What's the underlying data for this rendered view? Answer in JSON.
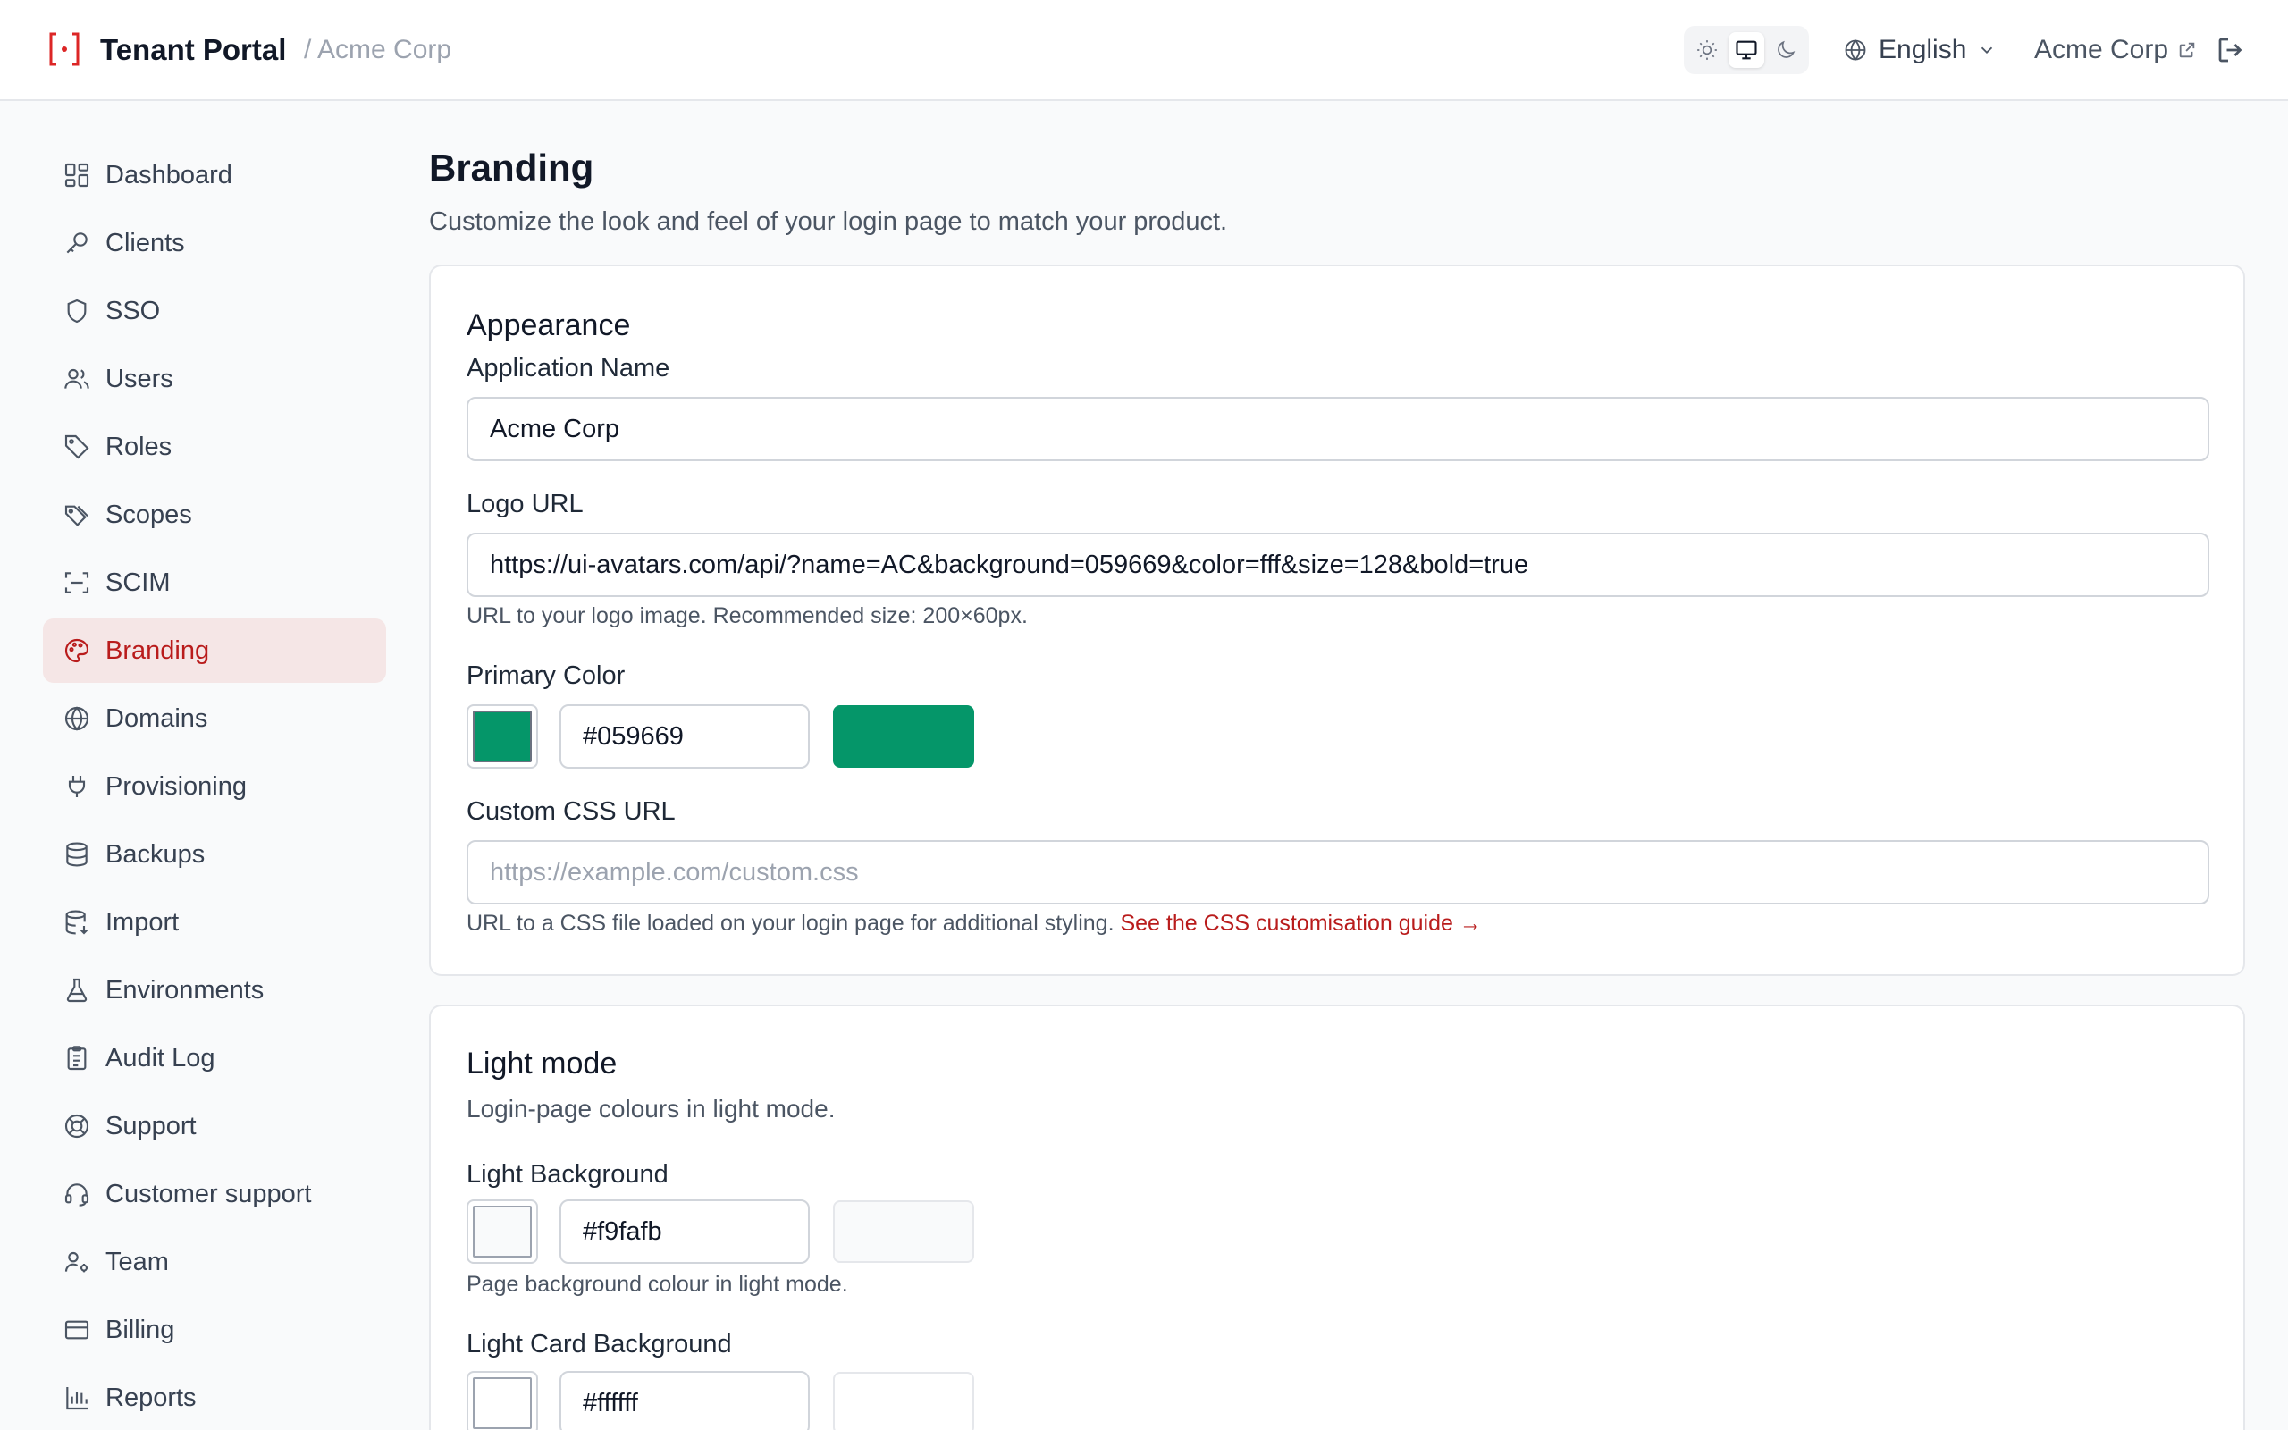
{
  "header": {
    "app_title": "Tenant Portal",
    "breadcrumb": "/ Acme Corp",
    "theme_options": [
      "light-icon",
      "system-icon",
      "dark-icon"
    ],
    "theme_active": "system",
    "language": "English",
    "tenant_link": "Acme Corp"
  },
  "sidebar": {
    "items": [
      {
        "label": "Dashboard",
        "icon": "dashboard-icon"
      },
      {
        "label": "Clients",
        "icon": "key-icon"
      },
      {
        "label": "SSO",
        "icon": "shield-icon"
      },
      {
        "label": "Users",
        "icon": "users-icon"
      },
      {
        "label": "Roles",
        "icon": "tag-icon"
      },
      {
        "label": "Scopes",
        "icon": "tags-icon"
      },
      {
        "label": "SCIM",
        "icon": "scan-icon"
      },
      {
        "label": "Branding",
        "icon": "palette-icon",
        "active": true
      },
      {
        "label": "Domains",
        "icon": "globe-icon"
      },
      {
        "label": "Provisioning",
        "icon": "plug-icon"
      },
      {
        "label": "Backups",
        "icon": "database-icon"
      },
      {
        "label": "Import",
        "icon": "database-import-icon"
      },
      {
        "label": "Environments",
        "icon": "flask-icon"
      },
      {
        "label": "Audit Log",
        "icon": "clipboard-icon"
      },
      {
        "label": "Support",
        "icon": "lifebuoy-icon"
      },
      {
        "label": "Customer support",
        "icon": "headset-icon"
      },
      {
        "label": "Team",
        "icon": "user-cog-icon"
      },
      {
        "label": "Billing",
        "icon": "credit-card-icon"
      },
      {
        "label": "Reports",
        "icon": "bar-chart-icon"
      }
    ]
  },
  "page": {
    "title": "Branding",
    "subtitle": "Customize the look and feel of your login page to match your product."
  },
  "appearance": {
    "title": "Appearance",
    "app_name_label": "Application Name",
    "app_name_value": "Acme Corp",
    "logo_url_label": "Logo URL",
    "logo_url_value": "https://ui-avatars.com/api/?name=AC&background=059669&color=fff&size=128&bold=true",
    "logo_url_hint": "URL to your logo image. Recommended size: 200×60px.",
    "primary_color_label": "Primary Color",
    "primary_color_value": "#059669",
    "custom_css_label": "Custom CSS URL",
    "custom_css_placeholder": "https://example.com/custom.css",
    "custom_css_hint": "URL to a CSS file loaded on your login page for additional styling.",
    "custom_css_link": "See the CSS customisation guide →"
  },
  "light_mode": {
    "title": "Light mode",
    "description": "Login-page colours in light mode.",
    "bg_label": "Light Background",
    "bg_value": "#f9fafb",
    "bg_hint": "Page background colour in light mode.",
    "card_bg_label": "Light Card Background",
    "card_bg_value": "#ffffff"
  },
  "colors": {
    "accent": "#b91c1c",
    "active_nav_bg": "#f5e6e6",
    "primary": "#059669"
  }
}
